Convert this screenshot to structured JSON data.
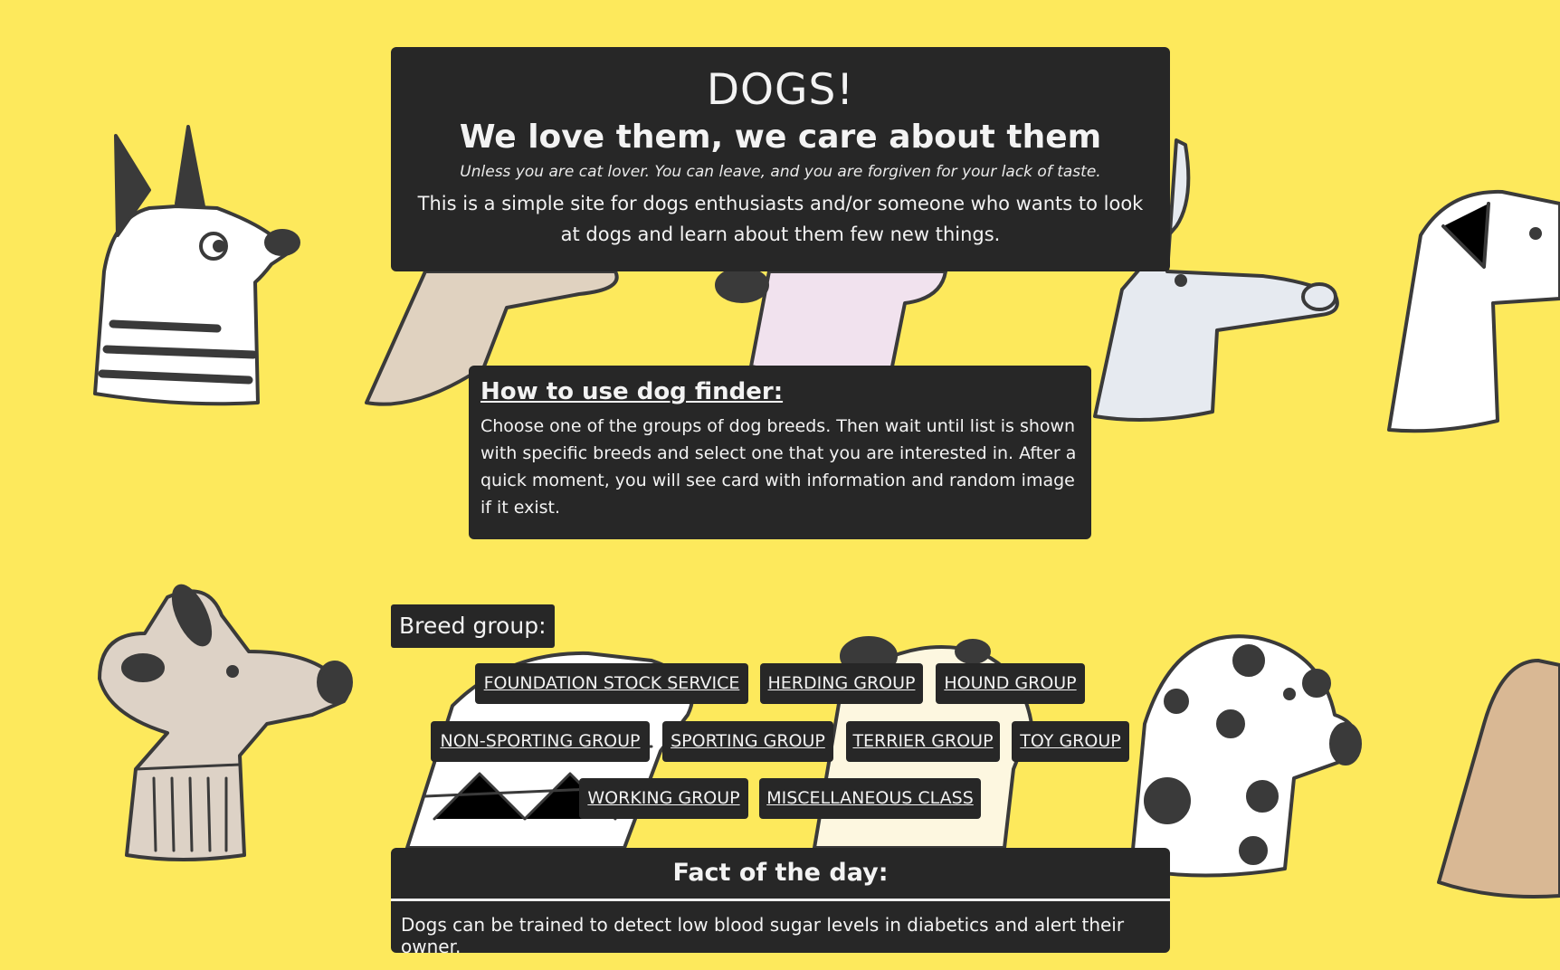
{
  "header": {
    "title": "DOGS!",
    "subtitle": "We love them, we care about them",
    "tagline": "Unless you are cat lover. You can leave, and you are forgiven for your lack of taste.",
    "intro": "This is a simple site for dogs enthusiasts and/or someone who wants to look at dogs and learn about them few new things."
  },
  "howto": {
    "title": "How to use dog finder:",
    "text": "Choose one of the groups of dog breeds. Then wait until list is shown with specific breeds and select one that you are interested in. After a quick moment, you will see card with information and random image if it exist."
  },
  "breed_group": {
    "label": "Breed group:",
    "groups": [
      "FOUNDATION STOCK SERVICE",
      "HERDING GROUP",
      "HOUND GROUP",
      "NON-SPORTING GROUP",
      "SPORTING GROUP",
      "TERRIER GROUP",
      "TOY GROUP",
      "WORKING GROUP",
      "MISCELLANEOUS CLASS"
    ]
  },
  "fact": {
    "title": "Fact of the day:",
    "text": "Dogs can be trained to detect low blood sugar levels in diabetics and alert their owner."
  },
  "colors": {
    "background": "#fde95c",
    "card": "#272727",
    "text": "#f3f3f3"
  }
}
